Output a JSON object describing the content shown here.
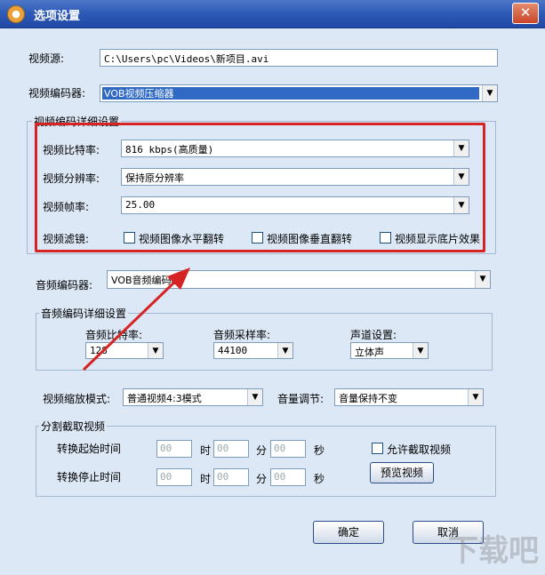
{
  "window": {
    "title": "选项设置",
    "close_glyph": "✕"
  },
  "video_source": {
    "label": "视频源:",
    "value": "C:\\Users\\pc\\Videos\\新项目.avi"
  },
  "video_encoder": {
    "label": "视频编码器:",
    "value": "VOB视频压缩器"
  },
  "video_details": {
    "title": "视频编码详细设置",
    "bitrate": {
      "label": "视频比特率:",
      "value": "816 kbps(高质量)"
    },
    "resolution": {
      "label": "视频分辨率:",
      "value": "保持原分辨率"
    },
    "framerate": {
      "label": "视频帧率:",
      "value": "25.00"
    },
    "filter": {
      "label": "视频滤镜:",
      "options": [
        "视频图像水平翻转",
        "视频图像垂直翻转",
        "视频显示底片效果"
      ]
    }
  },
  "audio_encoder": {
    "label": "音频编码器:",
    "value": "VOB音频编码器"
  },
  "audio_details": {
    "title": "音频编码详细设置",
    "bitrate": {
      "label": "音频比特率:",
      "value": "128"
    },
    "samplerate": {
      "label": "音频采样率:",
      "value": "44100"
    },
    "channel": {
      "label": "声道设置:",
      "value": "立体声"
    }
  },
  "scale_mode": {
    "label": "视频缩放模式:",
    "value": "普通视频4:3模式"
  },
  "volume": {
    "label": "音量调节:",
    "value": "音量保持不变"
  },
  "split": {
    "title": "分割截取视频",
    "start_label": "转换起始时间",
    "stop_label": "转换停止时间",
    "placeholder": "00",
    "unit_hour": "时",
    "unit_minute": "分",
    "unit_second": "秒",
    "allow_label": "允许截取视频",
    "preview_button": "预览视频"
  },
  "buttons": {
    "ok": "确定",
    "cancel": "取消"
  },
  "watermark": {
    "text": "下载吧"
  },
  "colors": {
    "title_bar": "#2f5cb7",
    "highlight_box": "#d62424",
    "arrow": "#d62424",
    "selection": "#316ac5"
  }
}
